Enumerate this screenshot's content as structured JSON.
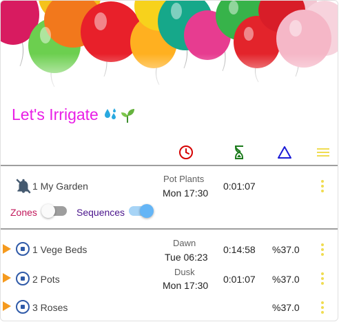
{
  "app": {
    "title": "Let's Irrigate",
    "title_emoji": "💦🌱"
  },
  "header": {
    "icons": [
      "clock-icon",
      "hourglass-icon",
      "triangle-icon",
      "menu-icon"
    ],
    "colors": {
      "clock": "#d50000",
      "hourglass": "#1b7a1b",
      "triangle": "#1a1ad6",
      "menu": "#f0dc50"
    }
  },
  "controller": {
    "name": "1 My Garden",
    "program": "Pot Plants",
    "next_run": "Mon 17:30",
    "duration": "0:01:07",
    "zones_label": "Zones",
    "sequences_label": "Sequences",
    "zones_enabled": false,
    "sequences_enabled": true
  },
  "zones": [
    {
      "name": "1 Vege Beds",
      "program": "Dawn",
      "next_run": "Tue 06:23",
      "duration": "0:14:58",
      "adjustment": "%37.0"
    },
    {
      "name": "2 Pots",
      "program": "Dusk",
      "next_run": "Mon 17:30",
      "duration": "0:01:07",
      "adjustment": "%37.0"
    },
    {
      "name": "3 Roses",
      "program": "",
      "next_run": "",
      "duration": "",
      "adjustment": "%37.0"
    }
  ],
  "colors": {
    "title": "#e91ee6",
    "zones_label": "#c2185b",
    "sequences_label": "#4a148c",
    "play": "#f59a1e",
    "stop": "#2f5aa8",
    "toggle_on": "#64b5f6"
  }
}
